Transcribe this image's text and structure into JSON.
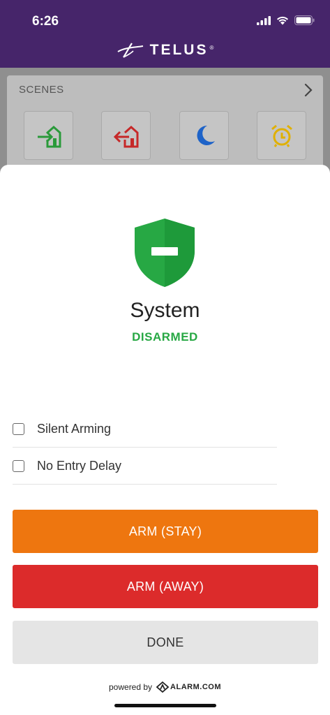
{
  "status_bar": {
    "time": "6:26"
  },
  "header": {
    "brand": "TELUS",
    "brand_mark": "®"
  },
  "scenes": {
    "title": "SCENES",
    "items": [
      {
        "icon": "arrive-home-icon",
        "color": "#2a9a3a"
      },
      {
        "icon": "leave-home-icon",
        "color": "#c62828"
      },
      {
        "icon": "moon-icon",
        "color": "#1e63c8"
      },
      {
        "icon": "alarm-clock-icon",
        "color": "#e0b000"
      }
    ]
  },
  "system": {
    "title": "System",
    "state": "DISARMED",
    "state_color": "#27a844"
  },
  "options": [
    {
      "label": "Silent Arming",
      "checked": false
    },
    {
      "label": "No Entry Delay",
      "checked": false
    }
  ],
  "buttons": {
    "arm_stay": "ARM (STAY)",
    "arm_away": "ARM (AWAY)",
    "done": "DONE"
  },
  "footer": {
    "powered_by": "powered by",
    "brand": "ALARM.COM"
  },
  "colors": {
    "header": "#46256a",
    "arm_stay": "#ee760f",
    "arm_away": "#dc2b2b",
    "done": "#e5e5e5"
  }
}
